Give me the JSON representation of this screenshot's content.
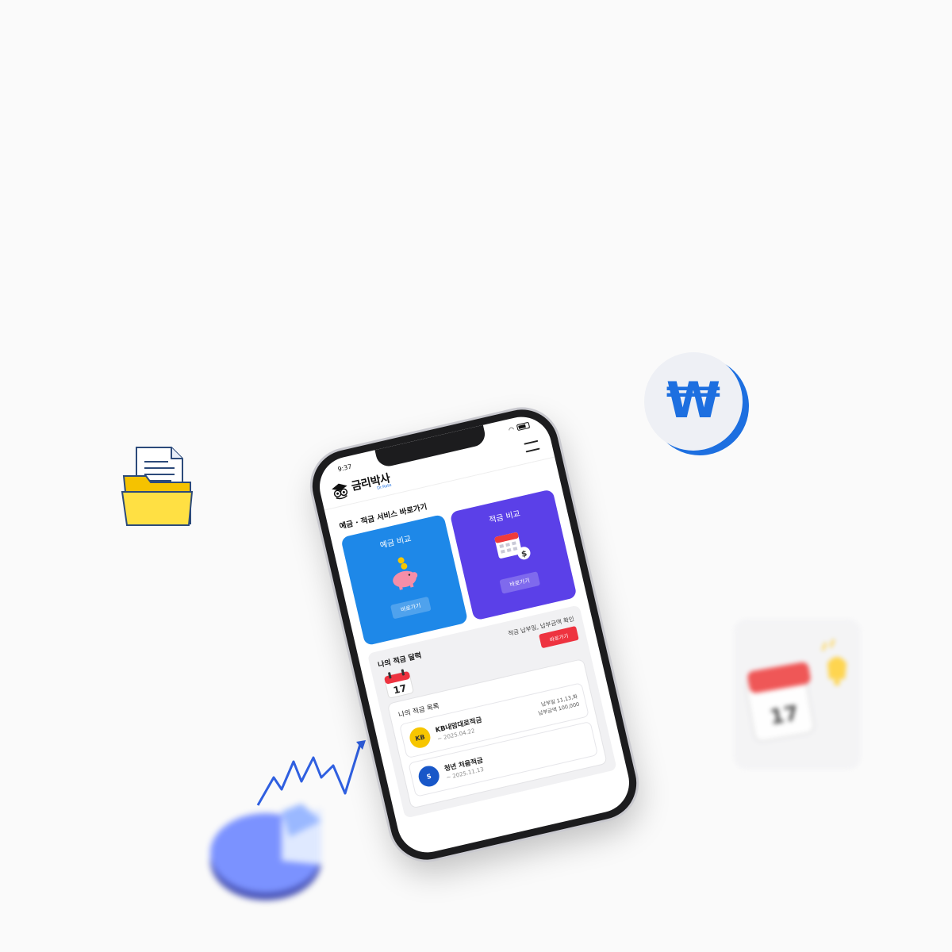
{
  "status_bar": {
    "time": "9:37"
  },
  "app": {
    "name": "금리박사",
    "tagline": "Dr.Rate"
  },
  "services": {
    "title": "예금 · 적금 서비스 바로가기",
    "cards": [
      {
        "title": "예금 비교",
        "button": "바로가기",
        "color": "#1e88e8",
        "icon": "piggy-bank-icon"
      },
      {
        "title": "적금 비교",
        "button": "바로가기",
        "color": "#5b40e8",
        "icon": "calendar-money-icon"
      }
    ]
  },
  "calendar": {
    "title": "나의 적금 달력",
    "description": "적금 납부일, 납부금액 확인",
    "button": "바로가기",
    "day": "17",
    "accent": "#ee3340"
  },
  "savings_list": {
    "title": "나의 적금 목록",
    "items": [
      {
        "bank": "KB",
        "name": "KB내맘대로적금",
        "date": "~ 2025.04.22",
        "pay_day": "납부일 11,13,화",
        "pay_amount": "납부금액 100,000"
      },
      {
        "bank": "S",
        "name": "청년 처음적금",
        "date": "~ 2025.11.13",
        "pay_day": "",
        "pay_amount": ""
      }
    ]
  },
  "decor": {
    "won_symbol": "₩",
    "calendar_day": "17"
  }
}
